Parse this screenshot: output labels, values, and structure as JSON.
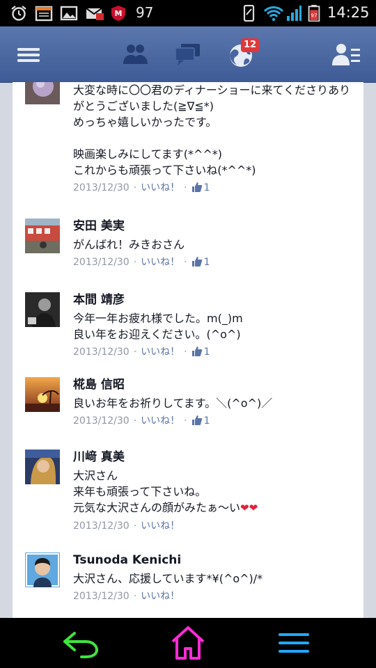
{
  "status_bar": {
    "notification_count": "97",
    "battery_label": "97",
    "time": "14:25",
    "icons": [
      "alarm-icon",
      "calendar-icon",
      "gallery-icon",
      "mail-icon",
      "mcafee-icon",
      "vibrate-icon",
      "wifi-icon",
      "signal-icon",
      "battery-icon"
    ]
  },
  "nav": {
    "icons": [
      "menu-icon",
      "friend-requests-icon",
      "messages-icon",
      "notifications-globe-icon",
      "friends-list-icon"
    ],
    "notifications_badge": "12",
    "colors": {
      "bar": "#4a66a0",
      "badge": "#e0383a"
    }
  },
  "comments": [
    {
      "name": "",
      "text": "大変な時に〇〇君のディナーショーに来てくださりありがとうございました(≧∇≦*)\nめっちゃ嬉しいかったです。\n\n映画楽しみにしてます(*^^*)\nこれからも頑張って下さいね(*^^*)",
      "date": "2013/12/30",
      "like_label": "いいね！",
      "like_count": "1"
    },
    {
      "name": "安田 美実",
      "text": "がんばれ！みきおさん",
      "date": "2013/12/30",
      "like_label": "いいね！",
      "like_count": "1"
    },
    {
      "name": "本間 靖彦",
      "text": "今年一年お疲れ様でした。m(_)m\n良い年をお迎えください。(^o^)",
      "date": "2013/12/30",
      "like_label": "いいね！",
      "like_count": "1"
    },
    {
      "name": "椛島 信昭",
      "text": "良いお年をお祈りしてます。＼(^o^)／",
      "date": "2013/12/30",
      "like_label": "いいね！",
      "like_count": "1"
    },
    {
      "name": "川﨑 真美",
      "text": "大沢さん\n来年も頑張って下さいね。\n元気な大沢さんの顔がみたぁ〜い",
      "date": "2013/12/30",
      "like_label": "いいね！",
      "like_count": ""
    },
    {
      "name": "Tsunoda  Kenichi",
      "text": "大沢さん、応援しています*¥(^o^)/*",
      "date": "2013/12/30",
      "like_label": "いいね！",
      "like_count": ""
    }
  ],
  "bottom_bar": {
    "icons": [
      "back-icon",
      "home-icon",
      "menu-icon"
    ],
    "colors": {
      "back": "#3ee63a",
      "home": "#ff2bd6",
      "menu": "#21a8ff"
    }
  }
}
